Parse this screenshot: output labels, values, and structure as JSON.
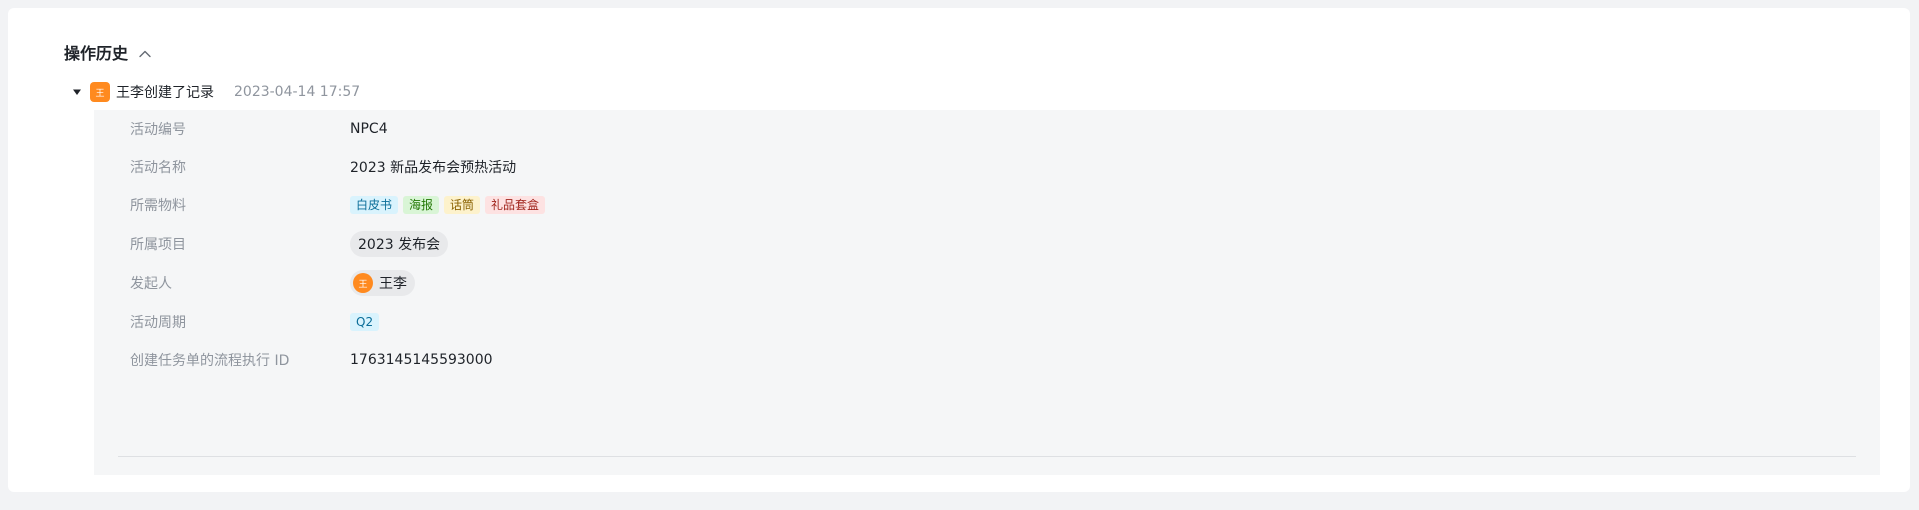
{
  "section": {
    "title": "操作历史"
  },
  "history": {
    "avatar_text": "王",
    "action": "王李创建了记录",
    "timestamp": "2023-04-14 17:57"
  },
  "fields": {
    "activity_id": {
      "label": "活动编号",
      "value": "NPC4"
    },
    "activity_name": {
      "label": "活动名称",
      "value": "2023 新品发布会预热活动"
    },
    "materials": {
      "label": "所需物料",
      "tags": [
        {
          "text": "白皮书",
          "bg": "#d9f3fd",
          "fg": "#0b6e99"
        },
        {
          "text": "海报",
          "bg": "#d9f5d6",
          "fg": "#237804"
        },
        {
          "text": "话筒",
          "bg": "#fdf2cc",
          "fg": "#8a6100"
        },
        {
          "text": "礼品套盒",
          "bg": "#fde2e2",
          "fg": "#a1261e"
        }
      ]
    },
    "project": {
      "label": "所属项目",
      "value": "2023 发布会"
    },
    "initiator": {
      "label": "发起人",
      "avatar_text": "王",
      "value": "王李"
    },
    "period": {
      "label": "活动周期",
      "value": "Q2",
      "bg": "#d9f3fd",
      "fg": "#0b6e99"
    },
    "flow_id": {
      "label": "创建任务单的流程执行 ID",
      "value": "1763145145593000"
    }
  },
  "colors": {
    "accent_orange": "#ff8a1f",
    "label_gray": "#8f959e",
    "panel_bg": "#f5f6f7"
  },
  "icons": {
    "collapse": "chevron-up-icon",
    "expand": "caret-down-icon"
  }
}
